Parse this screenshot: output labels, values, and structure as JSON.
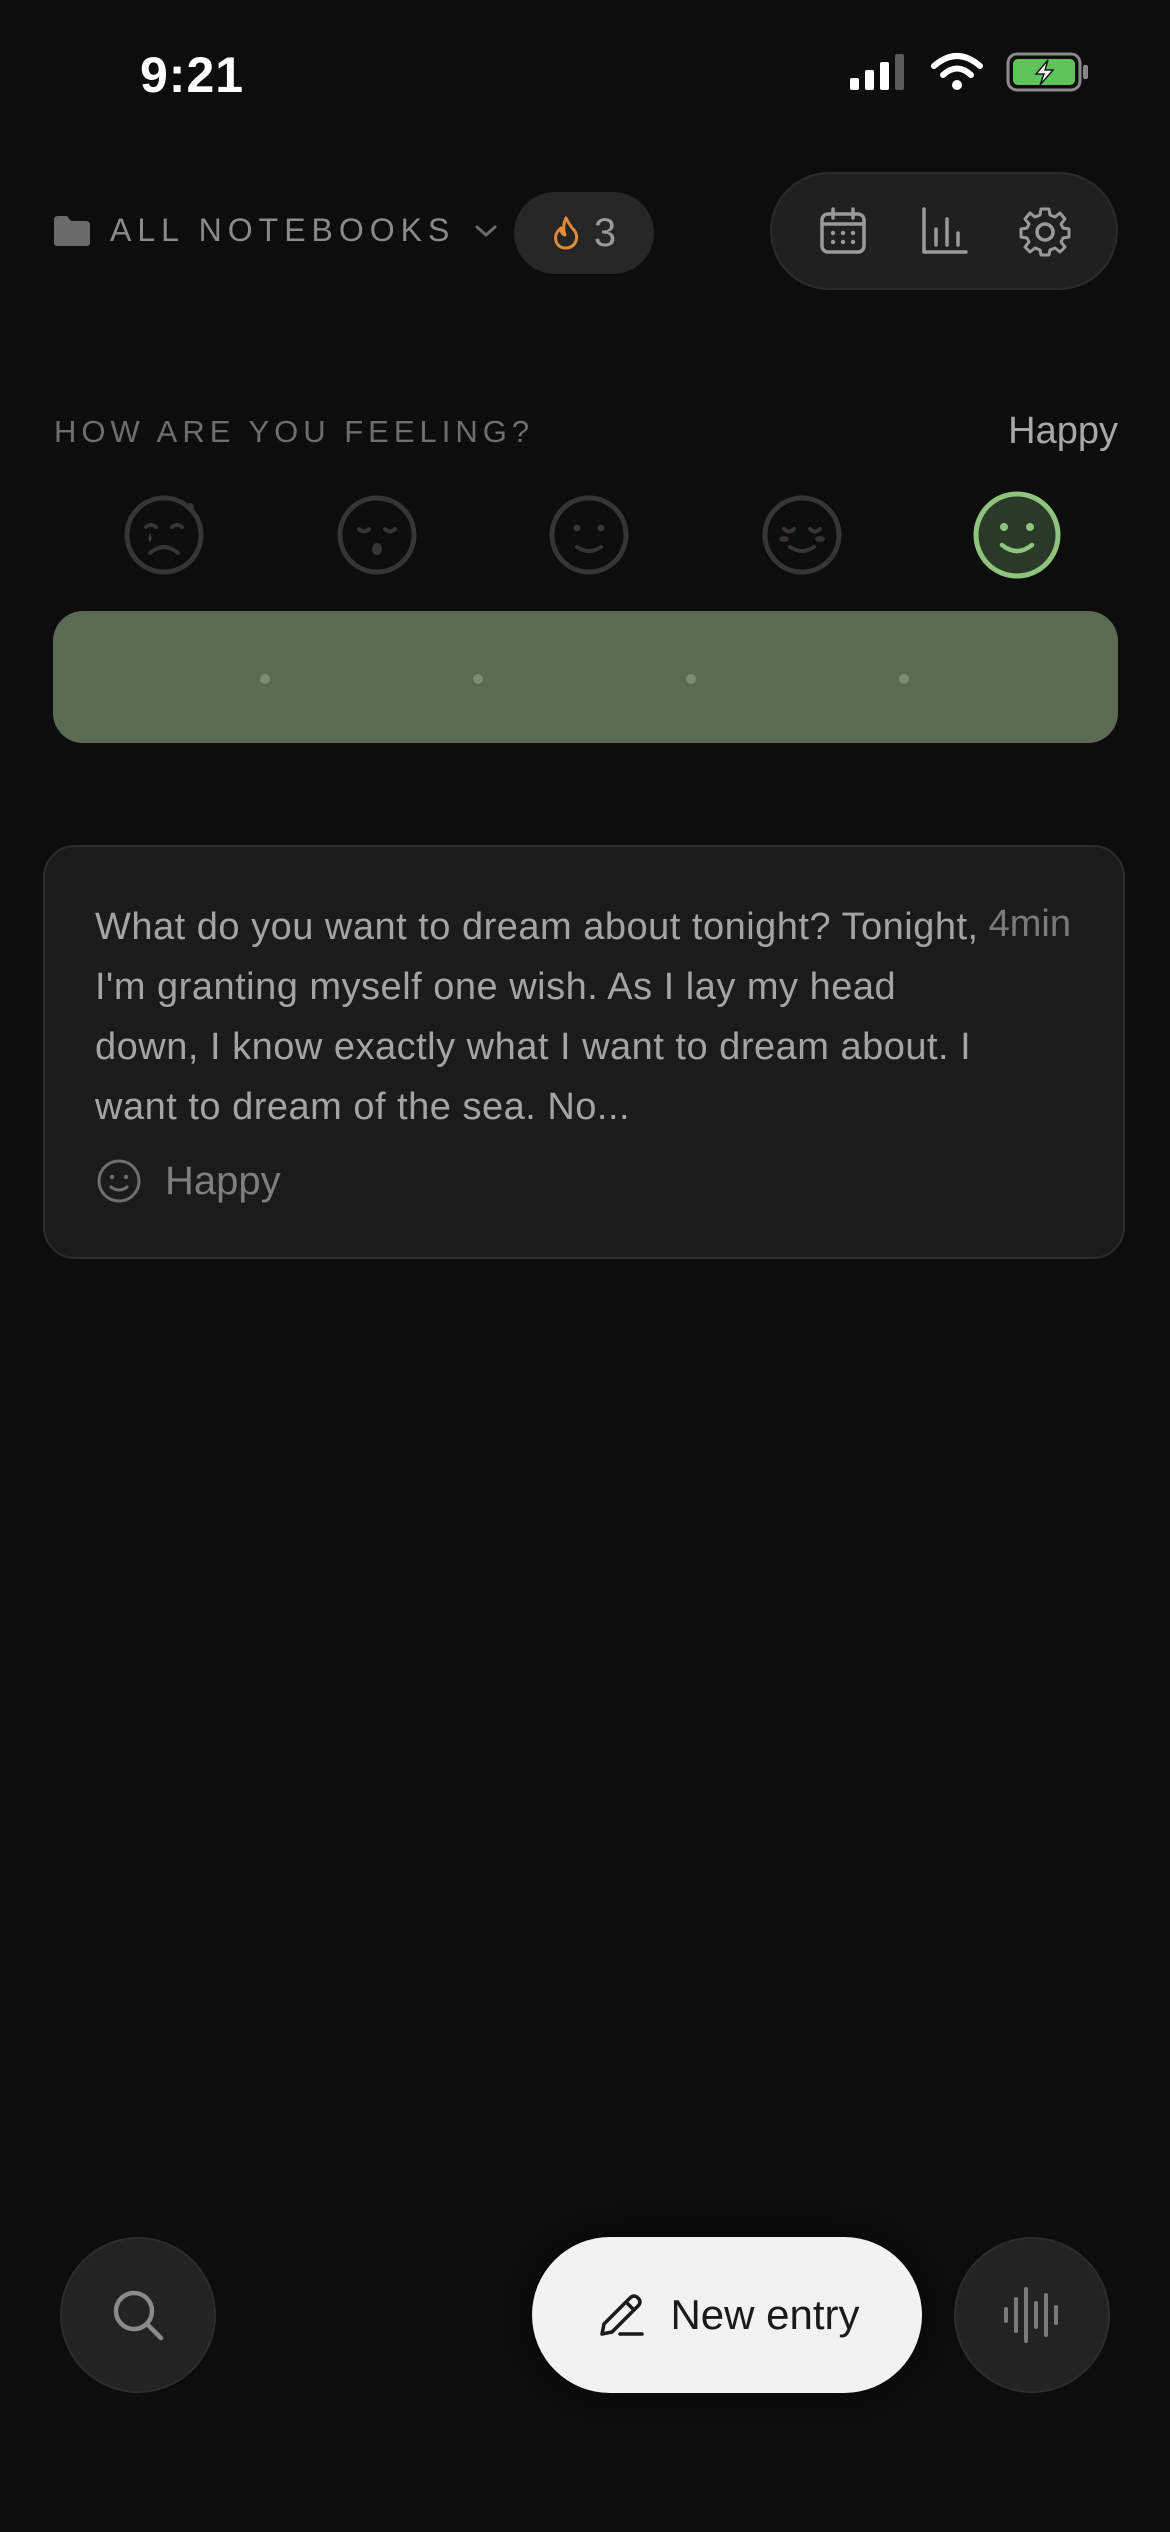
{
  "status_bar": {
    "time": "9:21"
  },
  "header": {
    "notebooks_label": "ALL NOTEBOOKS",
    "streak_count": "3",
    "toolbar_icons": [
      "calendar-icon",
      "bar-chart-icon",
      "gear-icon"
    ]
  },
  "mood": {
    "question": "HOW ARE YOU FEELING?",
    "current": "Happy",
    "options": [
      "very-sad-face-icon",
      "sad-face-icon",
      "neutral-face-icon",
      "content-face-icon",
      "happy-face-icon"
    ],
    "selected_index": 4,
    "accent_color": "#8fc47f",
    "track_color": "#5a6a53"
  },
  "entries": [
    {
      "text": "What do you want to dream about tonight? Tonight, I'm granting myself one wish. As I lay my head down, I know exactly what I want to dream about. I want to dream of the sea. No...",
      "duration": "4min",
      "mood_label": "Happy"
    }
  ],
  "bottom_bar": {
    "new_entry_label": "New entry"
  },
  "colors": {
    "background": "#0d0d0d",
    "card": "#1b1b1b",
    "streak_flame": "#e08a3a",
    "battery": "#5fc45a"
  }
}
